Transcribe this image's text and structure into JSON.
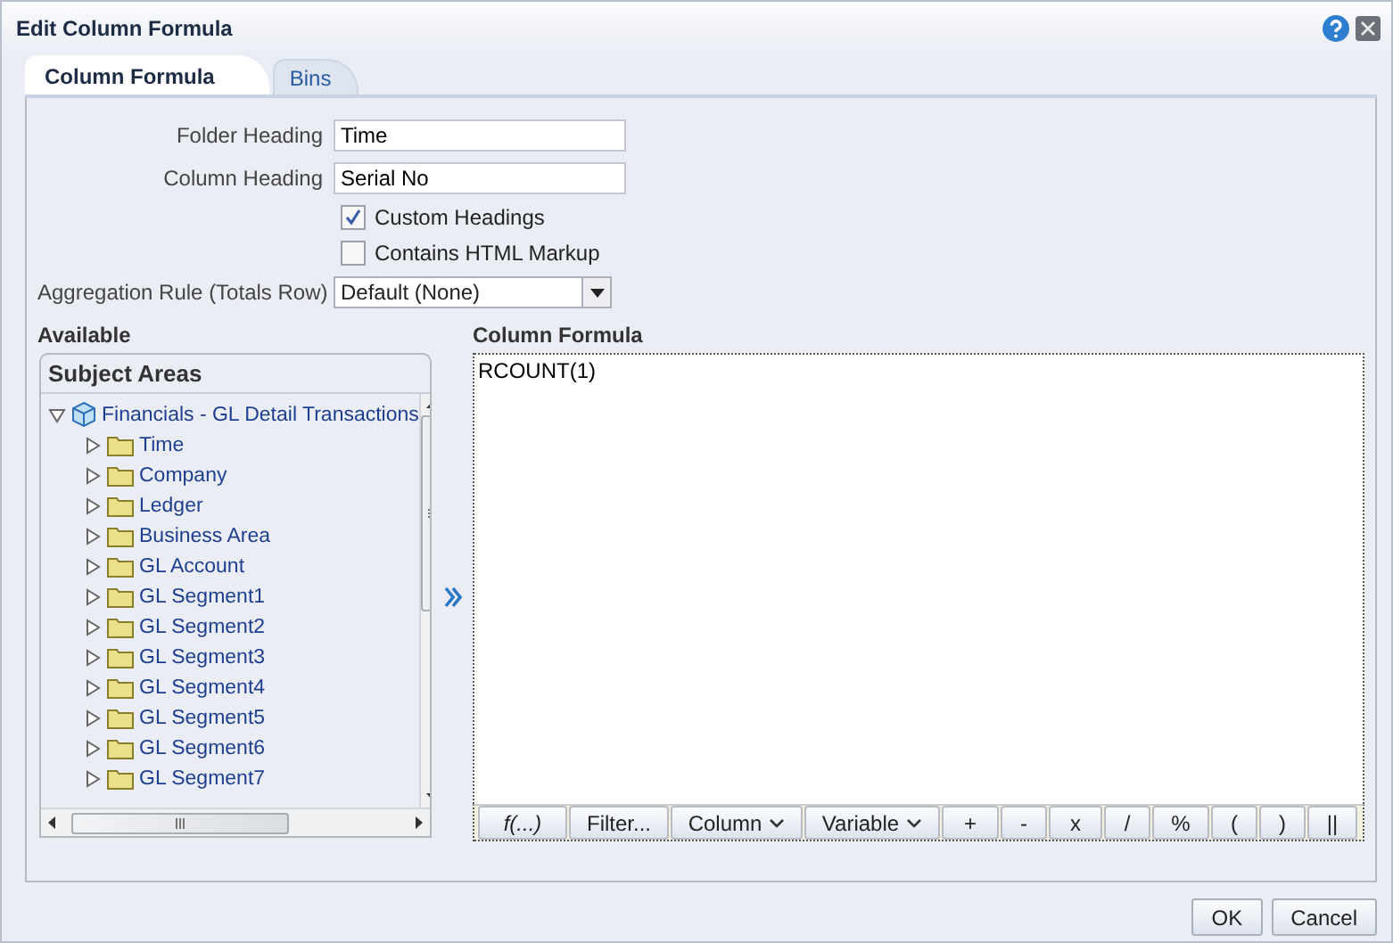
{
  "window": {
    "title": "Edit Column Formula"
  },
  "tabs": [
    {
      "label": "Column Formula",
      "selected": true
    },
    {
      "label": "Bins",
      "selected": false
    }
  ],
  "fields": [
    {
      "label": "Folder Heading",
      "value": "Time"
    },
    {
      "label": "Column Heading",
      "value": "Serial No"
    }
  ],
  "checkboxes": [
    {
      "label": "Custom Headings",
      "checked": true
    },
    {
      "label": "Contains HTML Markup",
      "checked": false
    }
  ],
  "aggregation": {
    "label": "Aggregation Rule (Totals Row)",
    "value": "Default (None)"
  },
  "available": {
    "heading": "Available",
    "panel_title": "Subject Areas",
    "tree": [
      {
        "label": "Financials - GL Detail Transactions",
        "expanded": true,
        "children": [
          {
            "label": "Time",
            "expanded": false
          },
          {
            "label": "Company",
            "expanded": false
          },
          {
            "label": "Ledger",
            "expanded": false
          },
          {
            "label": "Business Area",
            "expanded": false
          },
          {
            "label": "GL Account",
            "expanded": false
          },
          {
            "label": "GL Segment1",
            "expanded": false
          },
          {
            "label": "GL Segment2",
            "expanded": false
          },
          {
            "label": "GL Segment3",
            "expanded": false
          },
          {
            "label": "GL Segment4",
            "expanded": false
          },
          {
            "label": "GL Segment5",
            "expanded": false
          },
          {
            "label": "GL Segment6",
            "expanded": false
          },
          {
            "label": "GL Segment7",
            "expanded": false
          }
        ]
      }
    ]
  },
  "formula": {
    "heading": "Column Formula",
    "value": "RCOUNT(1)",
    "buttons": [
      {
        "label": "f(...)",
        "kind": "function"
      },
      {
        "label": "Filter...",
        "kind": "plain"
      },
      {
        "label": "Column",
        "kind": "menu"
      },
      {
        "label": "Variable",
        "kind": "menu"
      },
      {
        "label": "+",
        "kind": "plain"
      },
      {
        "label": "-",
        "kind": "plain"
      },
      {
        "label": "x",
        "kind": "plain"
      },
      {
        "label": "/",
        "kind": "plain"
      },
      {
        "label": "%",
        "kind": "plain"
      },
      {
        "label": "(",
        "kind": "plain"
      },
      {
        "label": ")",
        "kind": "plain"
      },
      {
        "label": "||",
        "kind": "plain"
      }
    ]
  },
  "footer_buttons": [
    "OK",
    "Cancel"
  ]
}
